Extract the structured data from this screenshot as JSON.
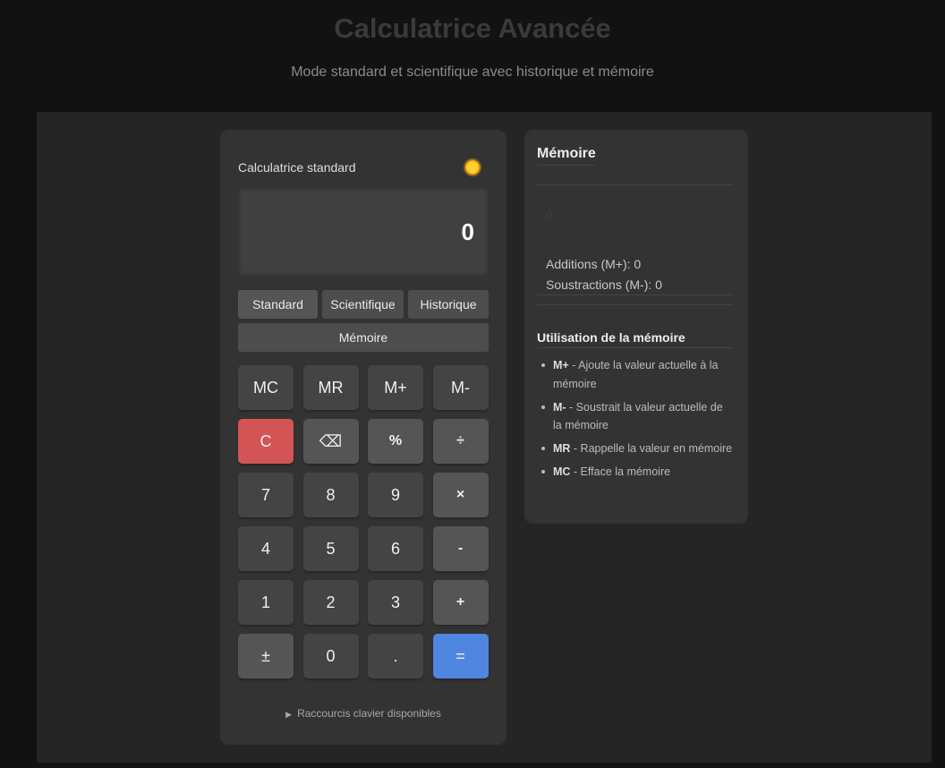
{
  "header": {
    "title": "Calculatrice Avancée",
    "subtitle": "Mode standard et scientifique avec historique et mémoire"
  },
  "calculator": {
    "title": "Calculatrice standard",
    "theme_icon": "sun-icon",
    "display": "0",
    "tabs": {
      "standard": "Standard",
      "scientific": "Scientifique",
      "history": "Historique",
      "memory": "Mémoire"
    },
    "active_tab": "Standard",
    "keys": [
      [
        "MC",
        "MR",
        "M+",
        "M-"
      ],
      [
        "C",
        "⌫",
        "%",
        "÷"
      ],
      [
        "7",
        "8",
        "9",
        "×"
      ],
      [
        "4",
        "5",
        "6",
        "-"
      ],
      [
        "1",
        "2",
        "3",
        "+"
      ],
      [
        "±",
        "0",
        ".",
        "="
      ]
    ],
    "shortcuts_label": "Raccourcis clavier disponibles"
  },
  "memory": {
    "title": "Mémoire",
    "value": "0",
    "additions": "Additions (M+): 0",
    "subtractions": "Soustractions (M-): 0",
    "usage_title": "Utilisation de la mémoire",
    "usage": [
      {
        "key": "M+",
        "text": " - Ajoute la valeur actuelle à la mémoire"
      },
      {
        "key": "M-",
        "text": " - Soustrait la valeur actuelle de la mémoire"
      },
      {
        "key": "MR",
        "text": " - Rappelle la valeur en mémoire"
      },
      {
        "key": "MC",
        "text": " - Efface la mémoire"
      }
    ]
  },
  "colors": {
    "equals_key": "#4f86e0",
    "clear_key": "#d35454",
    "background": "#121212",
    "panel": "#333333"
  }
}
